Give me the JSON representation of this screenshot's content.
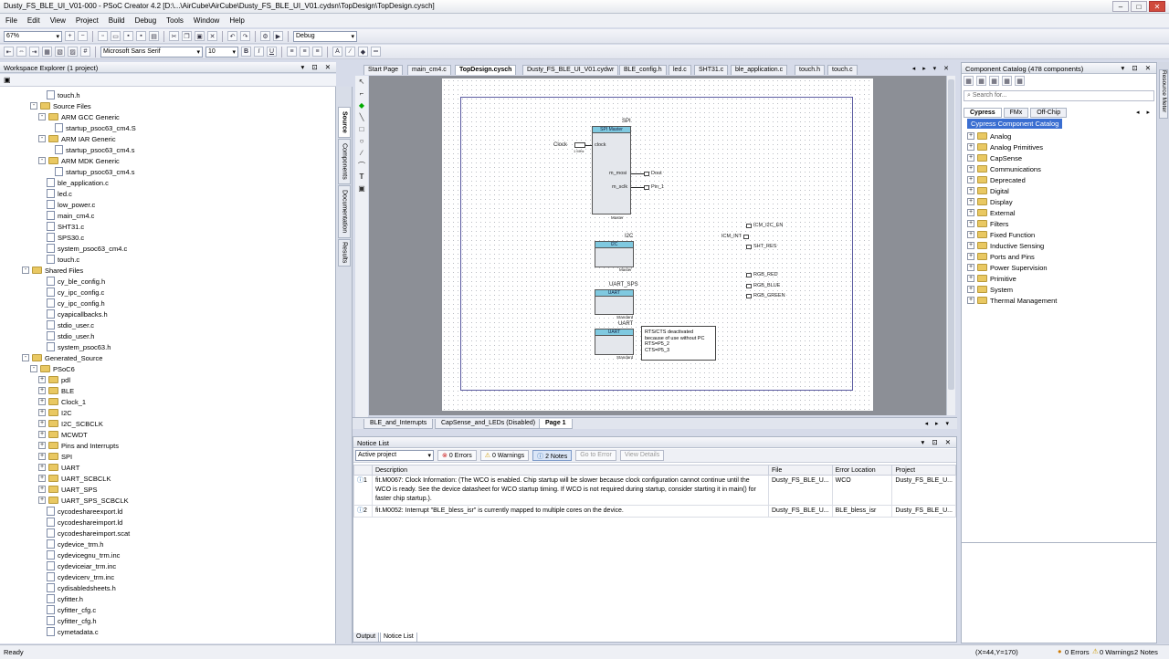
{
  "window": {
    "title": "Dusty_FS_BLE_UI_V01-000 - PSoC Creator 4.2  [D:\\...\\AirCube\\AirCube\\Dusty_FS_BLE_UI_V01.cydsn\\TopDesign\\TopDesign.cysch]"
  },
  "menu": [
    "File",
    "Edit",
    "View",
    "Project",
    "Build",
    "Debug",
    "Tools",
    "Window",
    "Help"
  ],
  "toolbar": {
    "zoom": "67%",
    "font": "Microsoft Sans Serif",
    "size": "10",
    "config": "Debug",
    "bold": "B",
    "italic": "I",
    "underline": "U"
  },
  "workspace": {
    "title": "Workspace Explorer (1 project)",
    "items": [
      {
        "label": "touch.h",
        "indent": 5,
        "type": "file"
      },
      {
        "label": "Source Files",
        "indent": 3,
        "type": "folder",
        "exp": "-"
      },
      {
        "label": "ARM GCC Generic",
        "indent": 4,
        "type": "folder",
        "exp": "-"
      },
      {
        "label": "startup_psoc63_cm4.S",
        "indent": 6,
        "type": "file"
      },
      {
        "label": "ARM IAR Generic",
        "indent": 4,
        "type": "folder",
        "exp": "-"
      },
      {
        "label": "startup_psoc63_cm4.s",
        "indent": 6,
        "type": "file"
      },
      {
        "label": "ARM MDK Generic",
        "indent": 4,
        "type": "folder",
        "exp": "-"
      },
      {
        "label": "startup_psoc63_cm4.s",
        "indent": 6,
        "type": "file"
      },
      {
        "label": "ble_application.c",
        "indent": 5,
        "type": "file"
      },
      {
        "label": "led.c",
        "indent": 5,
        "type": "file"
      },
      {
        "label": "low_power.c",
        "indent": 5,
        "type": "file"
      },
      {
        "label": "main_cm4.c",
        "indent": 5,
        "type": "file"
      },
      {
        "label": "SHT31.c",
        "indent": 5,
        "type": "file"
      },
      {
        "label": "SPS30.c",
        "indent": 5,
        "type": "file"
      },
      {
        "label": "system_psoc63_cm4.c",
        "indent": 5,
        "type": "file"
      },
      {
        "label": "touch.c",
        "indent": 5,
        "type": "file"
      },
      {
        "label": "Shared Files",
        "indent": 2,
        "type": "folder",
        "exp": "-"
      },
      {
        "label": "cy_ble_config.h",
        "indent": 5,
        "type": "file"
      },
      {
        "label": "cy_ipc_config.c",
        "indent": 5,
        "type": "file"
      },
      {
        "label": "cy_ipc_config.h",
        "indent": 5,
        "type": "file"
      },
      {
        "label": "cyapicallbacks.h",
        "indent": 5,
        "type": "file"
      },
      {
        "label": "stdio_user.c",
        "indent": 5,
        "type": "file"
      },
      {
        "label": "stdio_user.h",
        "indent": 5,
        "type": "file"
      },
      {
        "label": "system_psoc63.h",
        "indent": 5,
        "type": "file"
      },
      {
        "label": "Generated_Source",
        "indent": 2,
        "type": "folder",
        "exp": "-"
      },
      {
        "label": "PSoC6",
        "indent": 3,
        "type": "folder",
        "exp": "-"
      },
      {
        "label": "pdl",
        "indent": 4,
        "type": "folder",
        "exp": "+"
      },
      {
        "label": "BLE",
        "indent": 4,
        "type": "folder",
        "exp": "+"
      },
      {
        "label": "Clock_1",
        "indent": 4,
        "type": "folder",
        "exp": "+"
      },
      {
        "label": "I2C",
        "indent": 4,
        "type": "folder",
        "exp": "+"
      },
      {
        "label": "I2C_SCBCLK",
        "indent": 4,
        "type": "folder",
        "exp": "+"
      },
      {
        "label": "MCWDT",
        "indent": 4,
        "type": "folder",
        "exp": "+"
      },
      {
        "label": "Pins and Interrupts",
        "indent": 4,
        "type": "folder",
        "exp": "+"
      },
      {
        "label": "SPI",
        "indent": 4,
        "type": "folder",
        "exp": "+"
      },
      {
        "label": "UART",
        "indent": 4,
        "type": "folder",
        "exp": "+"
      },
      {
        "label": "UART_SCBCLK",
        "indent": 4,
        "type": "folder",
        "exp": "+"
      },
      {
        "label": "UART_SPS",
        "indent": 4,
        "type": "folder",
        "exp": "+"
      },
      {
        "label": "UART_SPS_SCBCLK",
        "indent": 4,
        "type": "folder",
        "exp": "+"
      },
      {
        "label": "cycodeshareexport.ld",
        "indent": 5,
        "type": "file"
      },
      {
        "label": "cycodeshareimport.ld",
        "indent": 5,
        "type": "file"
      },
      {
        "label": "cycodeshareimport.scat",
        "indent": 5,
        "type": "file"
      },
      {
        "label": "cydevice_trm.h",
        "indent": 5,
        "type": "file"
      },
      {
        "label": "cydevicegnu_trm.inc",
        "indent": 5,
        "type": "file"
      },
      {
        "label": "cydeviceiar_trm.inc",
        "indent": 5,
        "type": "file"
      },
      {
        "label": "cydevicerv_trm.inc",
        "indent": 5,
        "type": "file"
      },
      {
        "label": "cydisabledsheets.h",
        "indent": 5,
        "type": "file"
      },
      {
        "label": "cyfitter.h",
        "indent": 5,
        "type": "file"
      },
      {
        "label": "cyfitter_cfg.c",
        "indent": 5,
        "type": "file"
      },
      {
        "label": "cyfitter_cfg.h",
        "indent": 5,
        "type": "file"
      },
      {
        "label": "cymetadata.c",
        "indent": 5,
        "type": "file"
      }
    ]
  },
  "side_tabs": [
    "Source",
    "Components",
    "Documentation",
    "Results"
  ],
  "doc_tabs": [
    "Start Page",
    "main_cm4.c",
    "TopDesign.cysch",
    "Dusty_FS_BLE_UI_V01.cydwr",
    "BLE_config.h",
    "led.c",
    "SHT31.c",
    "ble_application.c",
    "touch.h",
    "touch.c"
  ],
  "schematic": {
    "spi": {
      "name": "SPI",
      "header": "SPI Master",
      "footer": "Master",
      "pin1": "m_mosi",
      "pin2": "m_sclk",
      "clk": "clock"
    },
    "clock": {
      "label": "Clock",
      "sub": "1 MHz"
    },
    "outputs": [
      "Dout",
      "Pin_1"
    ],
    "i2c": {
      "name": "I2C",
      "header": "I2C",
      "footer": "Master"
    },
    "uart_sps": {
      "name": "UART_SPS",
      "header": "UART",
      "footer": "Standard"
    },
    "uart": {
      "name": "UART",
      "header": "UART",
      "footer": "Standard"
    },
    "note": [
      "RTS/CTS deactivated",
      "because of use without PC",
      "RTS=P5_2",
      "CTS=P5_3"
    ],
    "pins_top": [
      "ICM_I2C_EN",
      "ICM_INT",
      "SHT_RES"
    ],
    "pins_rgb": [
      "RGB_RED",
      "RGB_BLUE",
      "RGB_GREEN"
    ]
  },
  "page_tabs": [
    "BLE_and_Interrupts",
    "CapSense_and_LEDs (Disabled)",
    "Page 1"
  ],
  "notice": {
    "title": "Notice List",
    "filter": "Active project",
    "errors": "0 Errors",
    "warnings": "0 Warnings",
    "notes": "2 Notes",
    "goto": "Go to Error",
    "view": "View Details",
    "columns": [
      "Description",
      "File",
      "Error Location",
      "Project"
    ],
    "rows": [
      {
        "num": "1",
        "desc": "fit.M0067: Clock Information: (The WCO is enabled. Chip startup will be slower because clock configuration cannot continue until the WCO is ready. See the device datasheet for WCO startup timing. If WCO is not required during startup, consider starting it in main() for faster chip startup.).",
        "file": "Dusty_FS_BLE_U...",
        "loc": "WCO",
        "project": "Dusty_FS_BLE_U..."
      },
      {
        "num": "2",
        "desc": "fit.M0052: Interrupt \"BLE_bless_isr\" is currently mapped to multiple cores on the device.",
        "file": "Dusty_FS_BLE_U...",
        "loc": "BLE_bless_isr",
        "project": "Dusty_FS_BLE_U..."
      }
    ]
  },
  "bottom_tabs": [
    "Output",
    "Notice List"
  ],
  "catalog": {
    "title": "Component Catalog (478 components)",
    "search": "Search for...",
    "tabs": [
      "Cypress",
      "FMx",
      "Off-Chip"
    ],
    "root": "Cypress Component Catalog",
    "items": [
      "Analog",
      "Analog Primitives",
      "CapSense",
      "Communications",
      "Deprecated",
      "Digital",
      "Display",
      "External",
      "Filters",
      "Fixed Function",
      "Inductive Sensing",
      "Ports and Pins",
      "Power Supervision",
      "Primitive",
      "System",
      "Thermal Management"
    ]
  },
  "side_strip": "Resource Meter",
  "status": {
    "left": "Ready",
    "coords": "(X=44,Y=170)",
    "errors": "0 Errors",
    "warnings": "0 Warnings",
    "notes": "2 Notes"
  }
}
